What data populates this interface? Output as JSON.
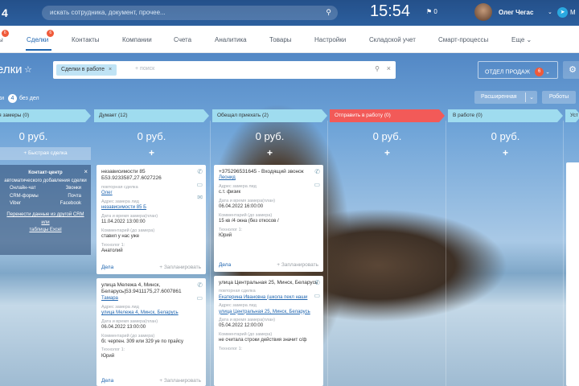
{
  "topbar": {
    "logo": "4",
    "search_placeholder": "искать сотрудника, документ, прочее...",
    "time": "15:54",
    "flag": "⚑ 0",
    "user_name": "Олег Чегас",
    "messenger_label": "М"
  },
  "menu": [
    {
      "label": "ы",
      "badge": "6"
    },
    {
      "label": "Сделки",
      "badge": "6",
      "active": true
    },
    {
      "label": "Контакты"
    },
    {
      "label": "Компании"
    },
    {
      "label": "Счета"
    },
    {
      "label": "Аналитика"
    },
    {
      "label": "Товары"
    },
    {
      "label": "Настройки"
    },
    {
      "label": "Складской учет"
    },
    {
      "label": "Смарт-процессы"
    },
    {
      "label": "Еще ⌄"
    }
  ],
  "page": {
    "title": "елки",
    "filter_chip": "Сделки в работе",
    "filter_placeholder": "+ поиск",
    "sales_button": "ОТДЕЛ ПРОДАЖ",
    "sales_count": "6",
    "sub_left": "ки",
    "sub_count": "4",
    "sub_right": "без дел",
    "extended_button": "Расширенная",
    "robots_button": "Роботы"
  },
  "columns": [
    {
      "head": "ащается замеры (0)",
      "sum": "0 руб."
    },
    {
      "head": "Думает (12)",
      "sum": "0 руб."
    },
    {
      "head": "Обещал приехать (2)",
      "sum": "0 руб."
    },
    {
      "head": "Отправить в работу (0)",
      "sum": "0 руб.",
      "red": true
    },
    {
      "head": "В работе (0)",
      "sum": "0 руб."
    },
    {
      "head": "Уст",
      "sum": ""
    }
  ],
  "quick_deal": "+ Быстрая сделка",
  "contact_center": {
    "title": "Контакт-центр",
    "subtitle": "автоматического добавления сделки",
    "rows": [
      [
        "Онлайн-чат",
        "Звонки"
      ],
      [
        "CRM-формы",
        "Почта"
      ],
      [
        "Viber",
        "Facebook"
      ]
    ],
    "link1": "Перенести данные из другой CRM или",
    "link2": "таблицы Excel"
  },
  "cards": {
    "c1": {
      "title": "независимости 85 Б53.9233587,27.6027226",
      "l1": "повторная сделка",
      "v1": "Олег",
      "l2": "Адрес замера лид",
      "v2": "независимости 85 Б",
      "l3": "Дата и время замера(план)",
      "v3": "11.04.2022 13:00:00",
      "l4": "Комментарий (до замера)",
      "v4": "ставил у нас уже",
      "l5": "Технолог 1:",
      "v5": "Анатолий",
      "act": "Дела",
      "plan": "+ Запланировать"
    },
    "c2": {
      "title": "улица Мележа 4, Минск, Беларусь|53.9411175,27.6007861",
      "v1": "Тамара",
      "l2": "Адрес замера лид",
      "v2": "улица Мележа 4, Минск, Беларусь",
      "l3": "Дата и время замера(план)",
      "v3": "06.04.2022 13:00:00",
      "l4": "Комментарий (до замера)",
      "v4": "бг. черпен. 309 или 329 уе по прайсу",
      "l5": "Технолог 1:",
      "v5": "Юрий",
      "act": "Дела",
      "plan": "+ Запланировать"
    },
    "c3": {
      "title": "+375296531645 - Входящий звонок",
      "v1": "Леонид",
      "l2": "Адрес замера лид",
      "v2": "с.т. физик",
      "l3": "Дата и время замера(план)",
      "v3": "06.04.2022 16:00:00",
      "l4": "Комментарий (до замера)",
      "v4": "15 кв /4 окна (без откосов /",
      "l5": "Технолог 1:",
      "v5": "Юрий",
      "act": "Дела",
      "plan": "+ Запланировать"
    },
    "c4": {
      "title": "улица Центральная 25, Минск, Беларусь",
      "l1": "повторная сделка",
      "v1": "Екатерина Ивановна (школа пекл наши",
      "l2": "Адрес замера лид",
      "v2": "улица Центральная 25, Минск, Беларусь",
      "l3": "Дата и время замера(план)",
      "v3": "05.04.2022 12:00:00",
      "l4": "Комментарий (до замера)",
      "v4": "не считала строки действия значит с/ф",
      "l5": "Технолог 1:"
    }
  },
  "colors": {
    "accent": "#2066b0",
    "stage": "#9fdcef",
    "stage_alert": "#f25a58",
    "badge": "#f05a3a"
  }
}
